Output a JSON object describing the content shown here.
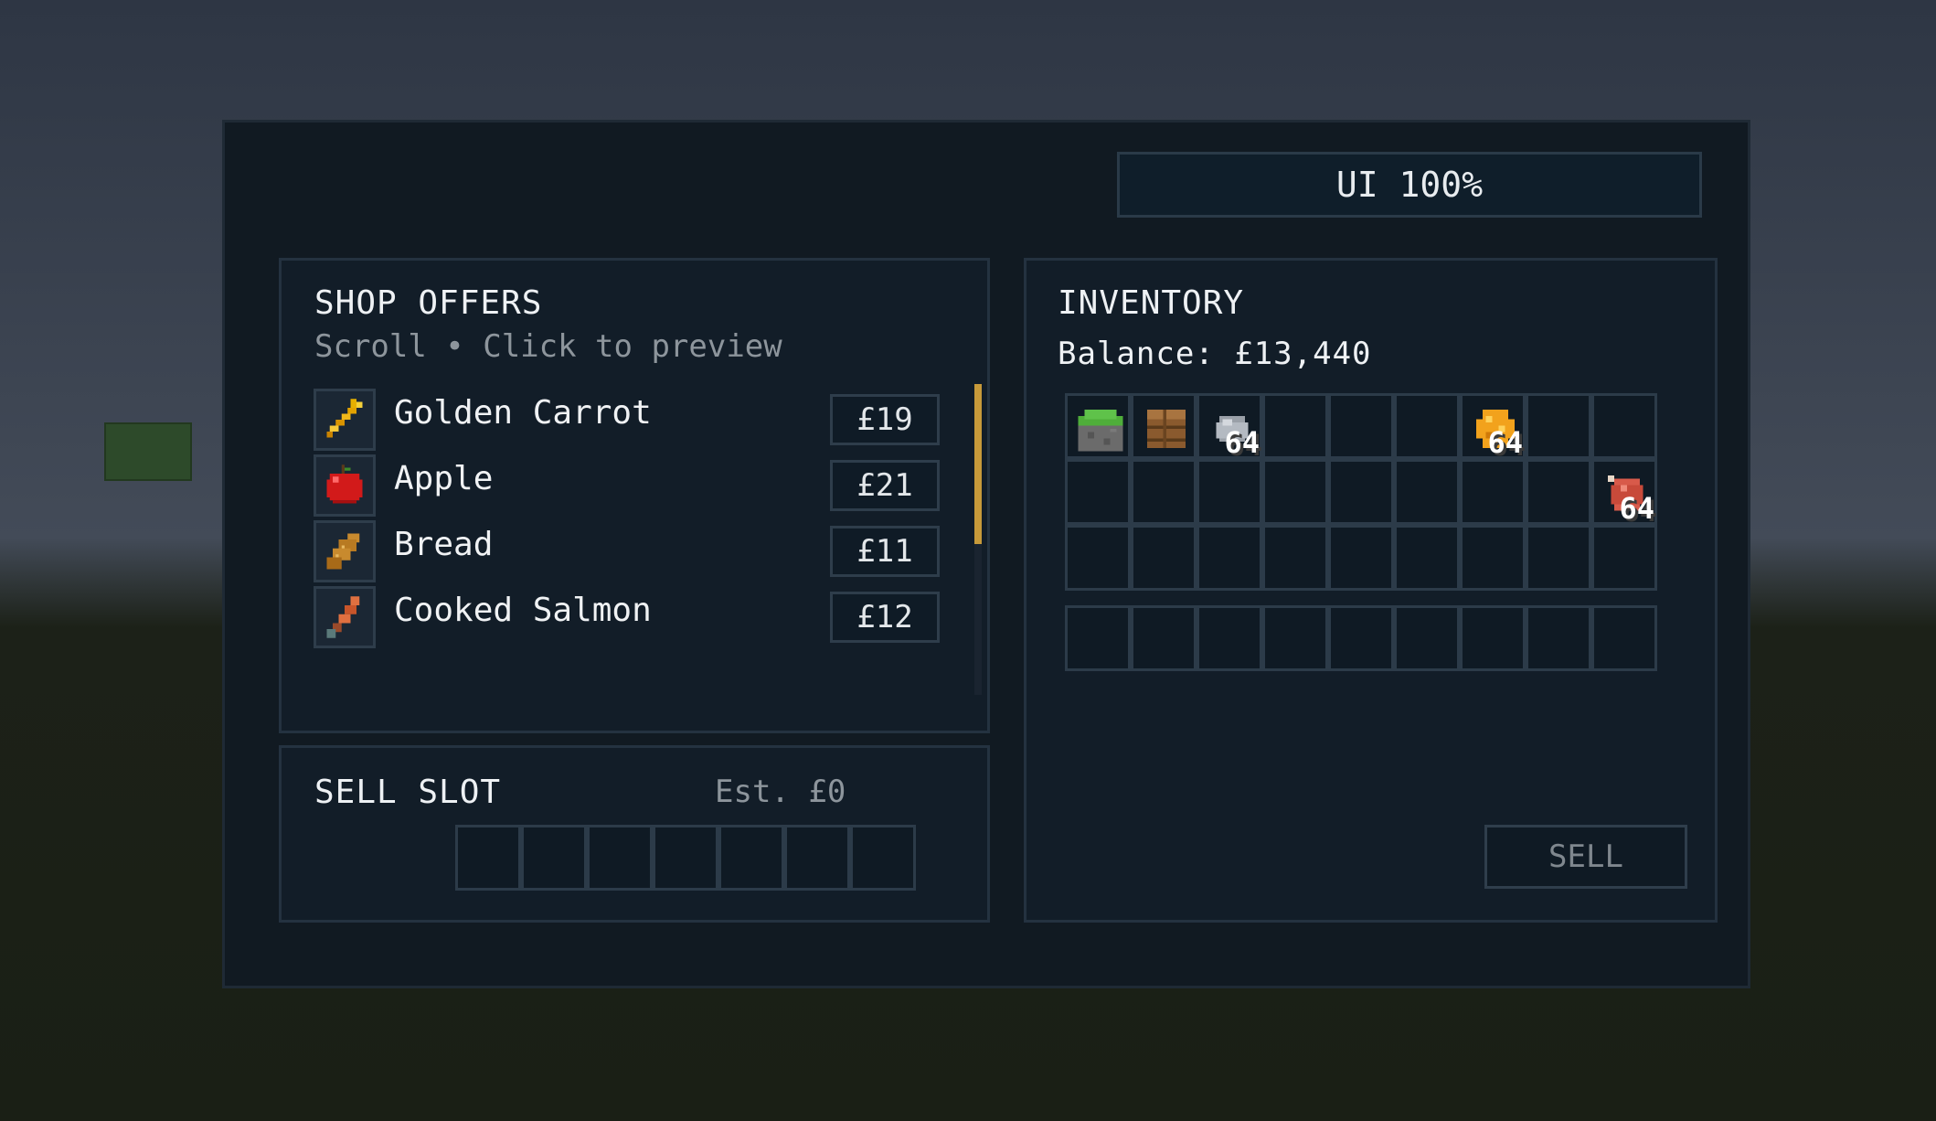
{
  "ui_scale": {
    "label": "UI 100%"
  },
  "shop": {
    "title": "SHOP OFFERS",
    "subtitle": "Scroll • Click to preview",
    "offers": [
      {
        "name": "Golden Carrot",
        "price": "£19",
        "icon": "golden-carrot-icon"
      },
      {
        "name": "Apple",
        "price": "£21",
        "icon": "apple-icon"
      },
      {
        "name": "Bread",
        "price": "£11",
        "icon": "bread-icon"
      },
      {
        "name": "Cooked Salmon",
        "price": "£12",
        "icon": "cooked-salmon-icon"
      }
    ],
    "scroll_position": 0
  },
  "sell_slot": {
    "title": "SELL SLOT",
    "estimate": "Est. £0",
    "slots": 7
  },
  "inventory": {
    "title": "INVENTORY",
    "balance": "Balance: £13,440",
    "items": [
      {
        "slot": 0,
        "icon": "grass-block-icon",
        "count": ""
      },
      {
        "slot": 1,
        "icon": "wooden-barrel-icon",
        "count": ""
      },
      {
        "slot": 2,
        "icon": "stone-ore-icon",
        "count": "64"
      },
      {
        "slot": 6,
        "icon": "honeycomb-icon",
        "count": "64"
      },
      {
        "slot": 17,
        "icon": "raw-meat-icon",
        "count": "64"
      }
    ],
    "sell_button": "SELL"
  },
  "colors": {
    "accent_scroll": "#c79a3a",
    "panel_bg": "#121d28",
    "border": "#2c3b49"
  }
}
